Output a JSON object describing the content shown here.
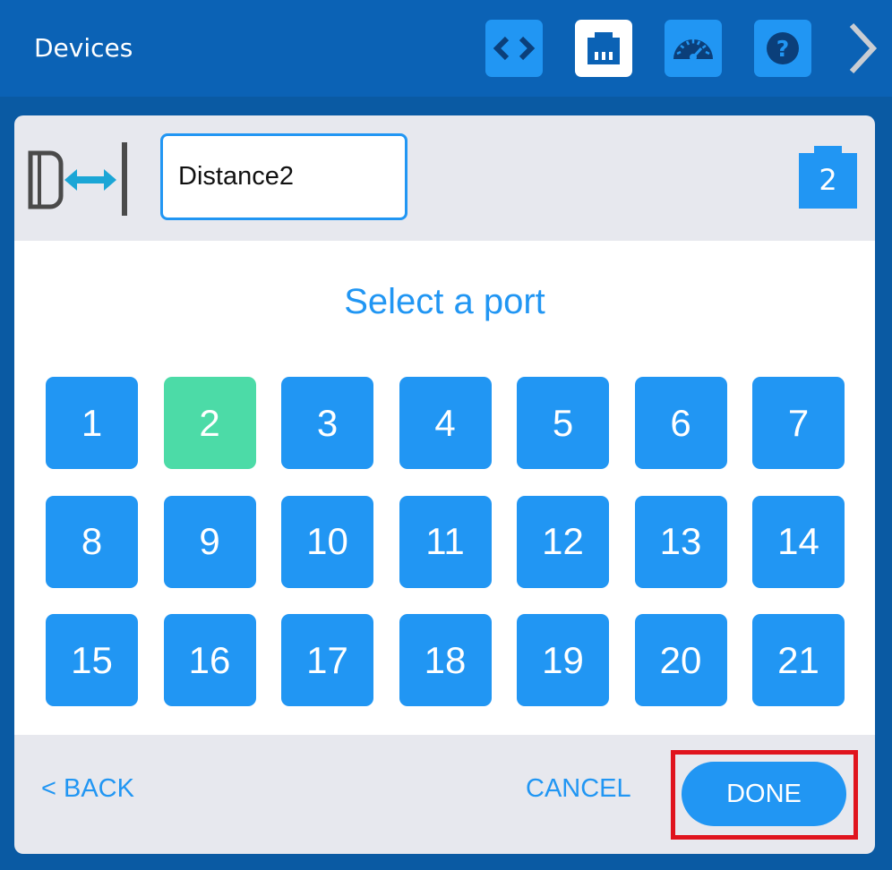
{
  "header": {
    "title": "Devices",
    "icons": [
      "code-icon",
      "port-icon",
      "dashboard-icon",
      "help-icon",
      "chevron-right-icon"
    ]
  },
  "device": {
    "icon": "distance-sensor-icon",
    "name": "Distance2",
    "port": "2"
  },
  "content": {
    "title": "Select a port",
    "ports": [
      "1",
      "2",
      "3",
      "4",
      "5",
      "6",
      "7",
      "8",
      "9",
      "10",
      "11",
      "12",
      "13",
      "14",
      "15",
      "16",
      "17",
      "18",
      "19",
      "20",
      "21"
    ],
    "selected_port": "2"
  },
  "footer": {
    "back_label": "< BACK",
    "cancel_label": "CANCEL",
    "done_label": "DONE"
  },
  "colors": {
    "header_bg": "#0b62b5",
    "accent": "#2196f3",
    "selected": "#4cdba7",
    "highlight": "#e0141e"
  }
}
